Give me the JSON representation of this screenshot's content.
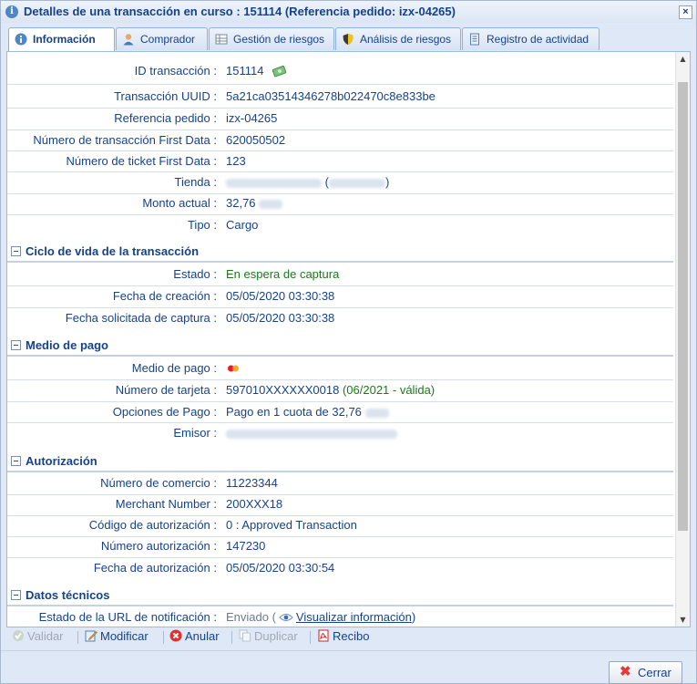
{
  "window": {
    "title": "Detalles de una transacción en curso : 151114 (Referencia pedido: izx-04265)",
    "close_label": "×"
  },
  "tabs": [
    {
      "label": "Información",
      "icon": "info-icon",
      "active": true
    },
    {
      "label": "Comprador",
      "icon": "user-icon"
    },
    {
      "label": "Gestión de riesgos",
      "icon": "grid-icon"
    },
    {
      "label": "Análisis de riesgos",
      "icon": "shield-icon"
    },
    {
      "label": "Registro de actividad",
      "icon": "document-icon"
    }
  ],
  "general": {
    "id_label": "ID transacción :",
    "id_value": "151114",
    "uuid_label": "Transacción UUID :",
    "uuid_value": "5a21ca03514346278b022470c8e833be",
    "ref_label": "Referencia pedido :",
    "ref_value": "izx-04265",
    "fd_label": "Número de transacción First Data :",
    "fd_value": "620050502",
    "ticket_label": "Número de ticket First Data :",
    "ticket_value": "123",
    "shop_label": "Tienda :",
    "shop_open": "(",
    "shop_close": ")",
    "amount_label": "Monto actual :",
    "amount_value": "32,76",
    "type_label": "Tipo :",
    "type_value": "Cargo"
  },
  "lifecycle": {
    "title": "Ciclo de vida de la transacción",
    "state_label": "Estado :",
    "state_value": "En espera de captura",
    "created_label": "Fecha de creación :",
    "created_value": "05/05/2020 03:30:38",
    "capture_label": "Fecha solicitada de captura :",
    "capture_value": "05/05/2020 03:30:38"
  },
  "payment": {
    "title": "Medio de pago",
    "method_label": "Medio de pago :",
    "card_label": "Número de tarjeta :",
    "card_value": "597010XXXXXX0018",
    "card_validity": "(06/2021 - válida)",
    "options_label": "Opciones de Pago :",
    "options_value": "Pago en 1 cuota de 32,76",
    "issuer_label": "Emisor :"
  },
  "authorization": {
    "title": "Autorización",
    "merchant_label": "Número de comercio :",
    "merchant_value": "11223344",
    "mnumber_label": "Merchant Number :",
    "mnumber_value": "200XXX18",
    "code_label": "Código de autorización :",
    "code_value": "0 : Approved Transaction",
    "authnum_label": "Número autorización :",
    "authnum_value": "147230",
    "authdate_label": "Fecha de autorización :",
    "authdate_value": "05/05/2020 03:30:54"
  },
  "technical": {
    "title": "Datos técnicos",
    "url_label": "Estado de la URL de notificación :",
    "url_value": "Enviado (",
    "url_link": "Visualizar información",
    "url_close": ")"
  },
  "toolbar": {
    "validate": "Validar",
    "modify": "Modificar",
    "cancel": "Anular",
    "duplicate": "Duplicar",
    "receipt": "Recibo"
  },
  "footer": {
    "close_label": "Cerrar"
  },
  "colors": {
    "accent": "#15428b",
    "success": "#1a7a1a",
    "panel_bg": "#dfe8f6"
  }
}
